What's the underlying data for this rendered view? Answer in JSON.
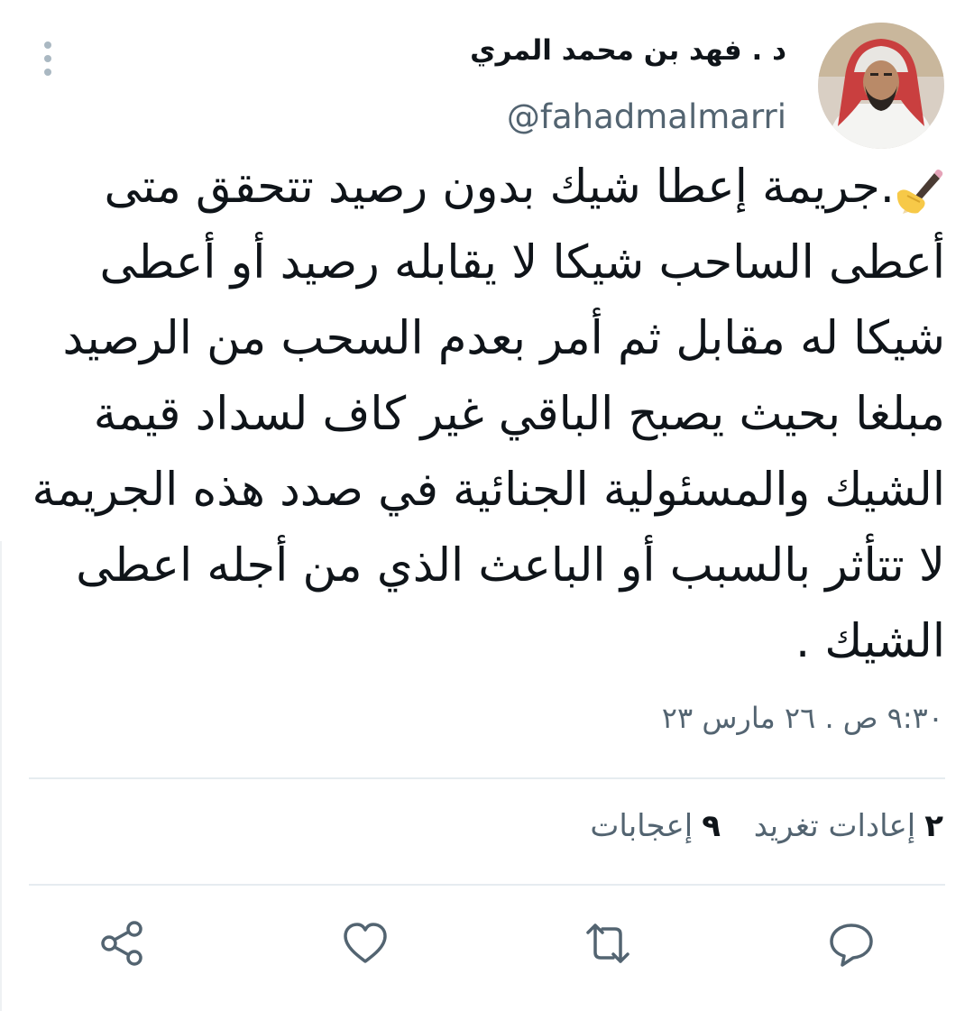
{
  "author": {
    "display_name": "د . فهد بن محمد المري",
    "handle": "@fahadmalmarri",
    "avatar": "profile-photo"
  },
  "tweet": {
    "prefix_icon": "writing-hand-icon",
    "text": ".جريمة إعطا شيك بدون رصيد تتحقق متى أعطى الساحب شيكا لا يقابله رصيد أو أعطى شيكا له مقابل ثم أمر بعدم السحب من الرصيد مبلغا بحيث يصبح الباقي غير كاف لسداد قيمة الشيك والمسئولية الجنائية في صدد هذه الجريمة لا تتأثر بالسبب أو الباعث الذي من أجله اعطى الشيك .",
    "timestamp": "٩:٣٠ ص . ٢٦ مارس ٢٣"
  },
  "stats": {
    "retweets_count": "٢",
    "retweets_label": "إعادات تغريد",
    "likes_count": "٩",
    "likes_label": "إعجابات"
  },
  "actions": [
    "reply-icon",
    "retweet-icon",
    "like-icon",
    "share-icon"
  ],
  "colors": {
    "text_primary": "#0f1419",
    "text_secondary": "#536471",
    "divider": "#e6ecf0",
    "icon": "#536471"
  }
}
